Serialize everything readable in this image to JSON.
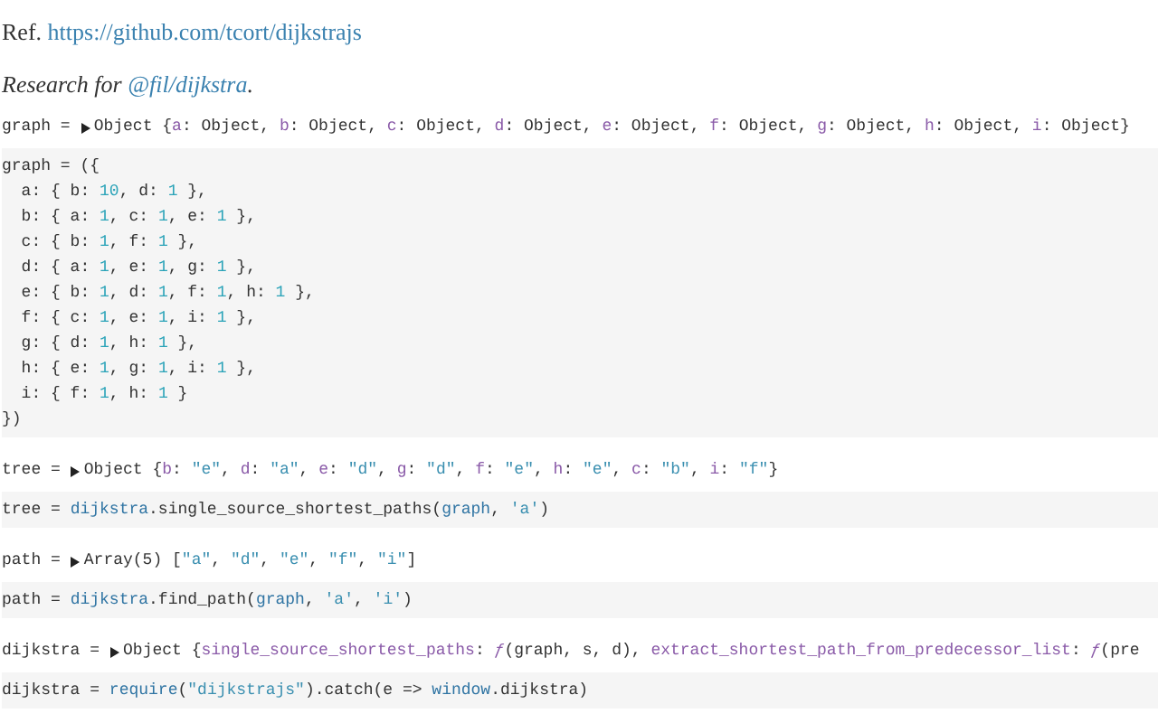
{
  "paragraphs": [
    {
      "italic": false,
      "parts": [
        {
          "text": "Ref. ",
          "link": false
        },
        {
          "text": "https://github.com/tcort/dijkstrajs",
          "link": true
        }
      ]
    },
    {
      "italic": true,
      "parts": [
        {
          "text": "Research for ",
          "link": false
        },
        {
          "text": "@fil/dijkstra",
          "link": true
        },
        {
          "text": ".",
          "link": false
        }
      ]
    }
  ],
  "cells": [
    {
      "kind": "output",
      "label": "graph =",
      "expanded": false,
      "tokens": [
        {
          "text": "Object {",
          "kind": "plain"
        },
        {
          "text": "a",
          "kind": "key"
        },
        {
          "text": ": Object, ",
          "kind": "plain"
        },
        {
          "text": "b",
          "kind": "key"
        },
        {
          "text": ": Object, ",
          "kind": "plain"
        },
        {
          "text": "c",
          "kind": "key"
        },
        {
          "text": ": Object, ",
          "kind": "plain"
        },
        {
          "text": "d",
          "kind": "key"
        },
        {
          "text": ": Object, ",
          "kind": "plain"
        },
        {
          "text": "e",
          "kind": "key"
        },
        {
          "text": ": Object, ",
          "kind": "plain"
        },
        {
          "text": "f",
          "kind": "key"
        },
        {
          "text": ": Object, ",
          "kind": "plain"
        },
        {
          "text": "g",
          "kind": "key"
        },
        {
          "text": ": Object, ",
          "kind": "plain"
        },
        {
          "text": "h",
          "kind": "key"
        },
        {
          "text": ": Object, ",
          "kind": "plain"
        },
        {
          "text": "i",
          "kind": "key"
        },
        {
          "text": ": Object}",
          "kind": "plain"
        }
      ]
    },
    {
      "kind": "code",
      "lines": [
        [
          {
            "text": "graph = ({",
            "kind": "plain"
          }
        ],
        [
          {
            "text": "  a: { b: ",
            "kind": "plain"
          },
          {
            "text": "10",
            "kind": "number"
          },
          {
            "text": ", d: ",
            "kind": "plain"
          },
          {
            "text": "1",
            "kind": "number"
          },
          {
            "text": " },",
            "kind": "plain"
          }
        ],
        [
          {
            "text": "  b: { a: ",
            "kind": "plain"
          },
          {
            "text": "1",
            "kind": "number"
          },
          {
            "text": ", c: ",
            "kind": "plain"
          },
          {
            "text": "1",
            "kind": "number"
          },
          {
            "text": ", e: ",
            "kind": "plain"
          },
          {
            "text": "1",
            "kind": "number"
          },
          {
            "text": " },",
            "kind": "plain"
          }
        ],
        [
          {
            "text": "  c: { b: ",
            "kind": "plain"
          },
          {
            "text": "1",
            "kind": "number"
          },
          {
            "text": ", f: ",
            "kind": "plain"
          },
          {
            "text": "1",
            "kind": "number"
          },
          {
            "text": " },",
            "kind": "plain"
          }
        ],
        [
          {
            "text": "  d: { a: ",
            "kind": "plain"
          },
          {
            "text": "1",
            "kind": "number"
          },
          {
            "text": ", e: ",
            "kind": "plain"
          },
          {
            "text": "1",
            "kind": "number"
          },
          {
            "text": ", g: ",
            "kind": "plain"
          },
          {
            "text": "1",
            "kind": "number"
          },
          {
            "text": " },",
            "kind": "plain"
          }
        ],
        [
          {
            "text": "  e: { b: ",
            "kind": "plain"
          },
          {
            "text": "1",
            "kind": "number"
          },
          {
            "text": ", d: ",
            "kind": "plain"
          },
          {
            "text": "1",
            "kind": "number"
          },
          {
            "text": ", f: ",
            "kind": "plain"
          },
          {
            "text": "1",
            "kind": "number"
          },
          {
            "text": ", h: ",
            "kind": "plain"
          },
          {
            "text": "1",
            "kind": "number"
          },
          {
            "text": " },",
            "kind": "plain"
          }
        ],
        [
          {
            "text": "  f: { c: ",
            "kind": "plain"
          },
          {
            "text": "1",
            "kind": "number"
          },
          {
            "text": ", e: ",
            "kind": "plain"
          },
          {
            "text": "1",
            "kind": "number"
          },
          {
            "text": ", i: ",
            "kind": "plain"
          },
          {
            "text": "1",
            "kind": "number"
          },
          {
            "text": " },",
            "kind": "plain"
          }
        ],
        [
          {
            "text": "  g: { d: ",
            "kind": "plain"
          },
          {
            "text": "1",
            "kind": "number"
          },
          {
            "text": ", h: ",
            "kind": "plain"
          },
          {
            "text": "1",
            "kind": "number"
          },
          {
            "text": " },",
            "kind": "plain"
          }
        ],
        [
          {
            "text": "  h: { e: ",
            "kind": "plain"
          },
          {
            "text": "1",
            "kind": "number"
          },
          {
            "text": ", g: ",
            "kind": "plain"
          },
          {
            "text": "1",
            "kind": "number"
          },
          {
            "text": ", i: ",
            "kind": "plain"
          },
          {
            "text": "1",
            "kind": "number"
          },
          {
            "text": " },",
            "kind": "plain"
          }
        ],
        [
          {
            "text": "  i: { f: ",
            "kind": "plain"
          },
          {
            "text": "1",
            "kind": "number"
          },
          {
            "text": ", h: ",
            "kind": "plain"
          },
          {
            "text": "1",
            "kind": "number"
          },
          {
            "text": " }",
            "kind": "plain"
          }
        ],
        [
          {
            "text": "})",
            "kind": "plain"
          }
        ]
      ]
    },
    {
      "kind": "output",
      "label": "tree =",
      "expanded": false,
      "tokens": [
        {
          "text": "Object {",
          "kind": "plain"
        },
        {
          "text": "b",
          "kind": "key"
        },
        {
          "text": ": ",
          "kind": "plain"
        },
        {
          "text": "\"e\"",
          "kind": "string"
        },
        {
          "text": ", ",
          "kind": "plain"
        },
        {
          "text": "d",
          "kind": "key"
        },
        {
          "text": ": ",
          "kind": "plain"
        },
        {
          "text": "\"a\"",
          "kind": "string"
        },
        {
          "text": ", ",
          "kind": "plain"
        },
        {
          "text": "e",
          "kind": "key"
        },
        {
          "text": ": ",
          "kind": "plain"
        },
        {
          "text": "\"d\"",
          "kind": "string"
        },
        {
          "text": ", ",
          "kind": "plain"
        },
        {
          "text": "g",
          "kind": "key"
        },
        {
          "text": ": ",
          "kind": "plain"
        },
        {
          "text": "\"d\"",
          "kind": "string"
        },
        {
          "text": ", ",
          "kind": "plain"
        },
        {
          "text": "f",
          "kind": "key"
        },
        {
          "text": ": ",
          "kind": "plain"
        },
        {
          "text": "\"e\"",
          "kind": "string"
        },
        {
          "text": ", ",
          "kind": "plain"
        },
        {
          "text": "h",
          "kind": "key"
        },
        {
          "text": ": ",
          "kind": "plain"
        },
        {
          "text": "\"e\"",
          "kind": "string"
        },
        {
          "text": ", ",
          "kind": "plain"
        },
        {
          "text": "c",
          "kind": "key"
        },
        {
          "text": ": ",
          "kind": "plain"
        },
        {
          "text": "\"b\"",
          "kind": "string"
        },
        {
          "text": ", ",
          "kind": "plain"
        },
        {
          "text": "i",
          "kind": "key"
        },
        {
          "text": ": ",
          "kind": "plain"
        },
        {
          "text": "\"f\"",
          "kind": "string"
        },
        {
          "text": "}",
          "kind": "plain"
        }
      ]
    },
    {
      "kind": "code",
      "lines": [
        [
          {
            "text": "tree = ",
            "kind": "plain"
          },
          {
            "text": "dijkstra",
            "kind": "identifier"
          },
          {
            "text": ".single_source_shortest_paths(",
            "kind": "plain"
          },
          {
            "text": "graph",
            "kind": "identifier"
          },
          {
            "text": ", ",
            "kind": "plain"
          },
          {
            "text": "'a'",
            "kind": "string"
          },
          {
            "text": ")",
            "kind": "plain"
          }
        ]
      ]
    },
    {
      "kind": "output",
      "label": "path =",
      "expanded": false,
      "tokens": [
        {
          "text": "Array(5) [",
          "kind": "plain"
        },
        {
          "text": "\"a\"",
          "kind": "string"
        },
        {
          "text": ", ",
          "kind": "plain"
        },
        {
          "text": "\"d\"",
          "kind": "string"
        },
        {
          "text": ", ",
          "kind": "plain"
        },
        {
          "text": "\"e\"",
          "kind": "string"
        },
        {
          "text": ", ",
          "kind": "plain"
        },
        {
          "text": "\"f\"",
          "kind": "string"
        },
        {
          "text": ", ",
          "kind": "plain"
        },
        {
          "text": "\"i\"",
          "kind": "string"
        },
        {
          "text": "]",
          "kind": "plain"
        }
      ]
    },
    {
      "kind": "code",
      "lines": [
        [
          {
            "text": "path = ",
            "kind": "plain"
          },
          {
            "text": "dijkstra",
            "kind": "identifier"
          },
          {
            "text": ".find_path(",
            "kind": "plain"
          },
          {
            "text": "graph",
            "kind": "identifier"
          },
          {
            "text": ", ",
            "kind": "plain"
          },
          {
            "text": "'a'",
            "kind": "string"
          },
          {
            "text": ", ",
            "kind": "plain"
          },
          {
            "text": "'i'",
            "kind": "string"
          },
          {
            "text": ")",
            "kind": "plain"
          }
        ]
      ]
    },
    {
      "kind": "output",
      "label": "dijkstra =",
      "expanded": false,
      "tokens": [
        {
          "text": "Object {",
          "kind": "plain"
        },
        {
          "text": "single_source_shortest_paths",
          "kind": "key"
        },
        {
          "text": ": ",
          "kind": "plain"
        },
        {
          "text": "ƒ",
          "kind": "function"
        },
        {
          "text": "(graph, s, d), ",
          "kind": "plain"
        },
        {
          "text": "extract_shortest_path_from_predecessor_list",
          "kind": "key"
        },
        {
          "text": ": ",
          "kind": "plain"
        },
        {
          "text": "ƒ",
          "kind": "function"
        },
        {
          "text": "(pre",
          "kind": "plain"
        }
      ]
    },
    {
      "kind": "code",
      "lines": [
        [
          {
            "text": "dijkstra = ",
            "kind": "plain"
          },
          {
            "text": "require",
            "kind": "identifier"
          },
          {
            "text": "(",
            "kind": "plain"
          },
          {
            "text": "\"dijkstrajs\"",
            "kind": "string"
          },
          {
            "text": ").catch(e => ",
            "kind": "plain"
          },
          {
            "text": "window",
            "kind": "identifier"
          },
          {
            "text": ".dijkstra)",
            "kind": "plain"
          }
        ]
      ]
    }
  ]
}
